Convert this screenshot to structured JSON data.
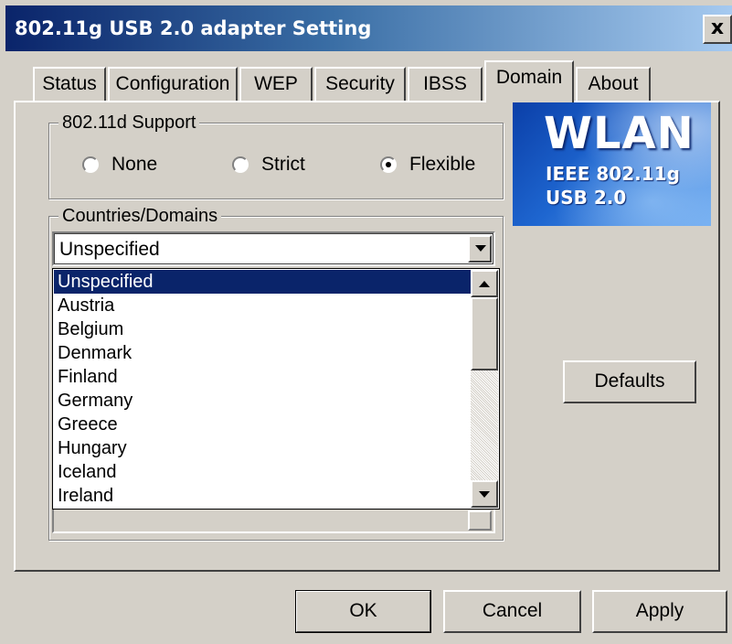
{
  "window": {
    "title": "802.11g USB 2.0 adapter Setting",
    "close_label": "x"
  },
  "tabs": [
    {
      "label": "Status",
      "active": false
    },
    {
      "label": "Configuration",
      "active": false
    },
    {
      "label": "WEP",
      "active": false
    },
    {
      "label": "Security",
      "active": false
    },
    {
      "label": "IBSS",
      "active": false
    },
    {
      "label": "Domain",
      "active": true
    },
    {
      "label": "About",
      "active": false
    }
  ],
  "support_group": {
    "legend": "802.11d Support",
    "options": [
      {
        "label": "None",
        "checked": false
      },
      {
        "label": "Strict",
        "checked": false
      },
      {
        "label": "Flexible",
        "checked": true
      }
    ]
  },
  "countries_group": {
    "legend": "Countries/Domains",
    "selected_value": "Unspecified",
    "dropdown_items": [
      "Unspecified",
      "Austria",
      "Belgium",
      "Denmark",
      "Finland",
      "Germany",
      "Greece",
      "Hungary",
      "Iceland",
      "Ireland"
    ],
    "highlighted_index": 0
  },
  "logo": {
    "title": "WLAN",
    "line1": "IEEE 802.11g",
    "line2": "USB 2.0",
    "color": "#1e66d0"
  },
  "buttons": {
    "defaults": "Defaults",
    "ok": "OK",
    "cancel": "Cancel",
    "apply": "Apply"
  },
  "colors": {
    "dialog_face": "#d4d0c8",
    "title_bar_start": "#0a246a",
    "selection": "#0a246a"
  }
}
